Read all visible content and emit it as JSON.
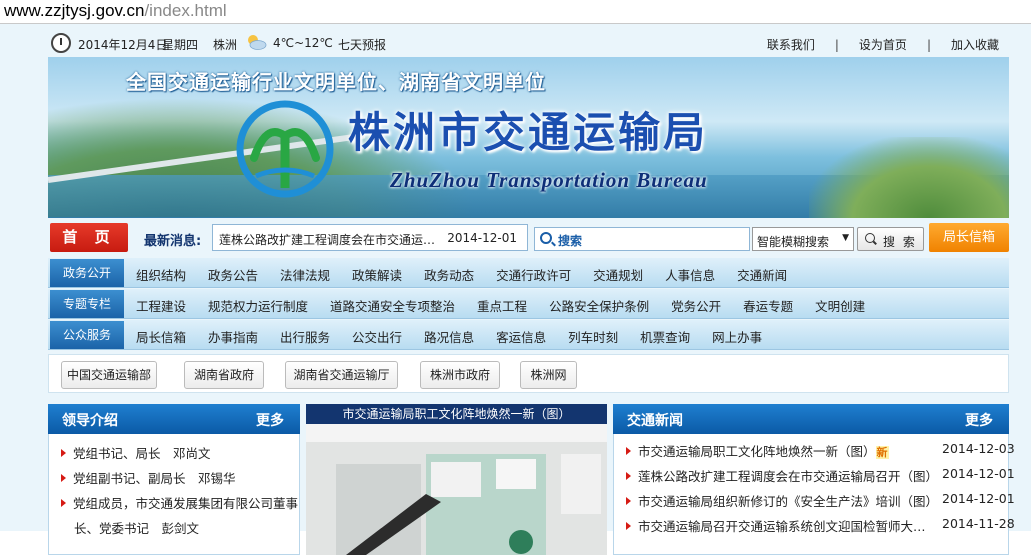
{
  "url": {
    "host": "www.zzjtysj.gov.cn",
    "path": "/index.html"
  },
  "topbar": {
    "date": "2014年12月4日",
    "weekday": "星期四",
    "city": "株洲",
    "temp": "4℃~12℃",
    "forecast": "七天预报",
    "links": [
      "联系我们",
      "设为首页",
      "加入收藏"
    ],
    "separator": "|"
  },
  "banner": {
    "slogan": "全国交通运输行业文明单位、湖南省文明单位",
    "title": "株洲市交通运输局",
    "subtitle": "ZhuZhou Transportation Bureau"
  },
  "searchbar": {
    "home": "首 页",
    "news_label": "最新消息:",
    "news_title": "莲株公路改扩建工程调度会在市交通运…",
    "news_date": "2014-12-01",
    "search_placeholder": "搜索",
    "search_mode": "智能模糊搜索",
    "search_button": "搜 索",
    "mailbox": "局长信箱"
  },
  "nav": [
    {
      "tag": "政务公开",
      "items": [
        "组织结构",
        "政务公告",
        "法律法规",
        "政策解读",
        "政务动态",
        "交通行政许可",
        "交通规划",
        "人事信息",
        "交通新闻"
      ]
    },
    {
      "tag": "专题专栏",
      "items": [
        "工程建设",
        "规范权力运行制度",
        "道路交通安全专项整治",
        "重点工程",
        "公路安全保护条例",
        "党务公开",
        "春运专题",
        "文明创建"
      ]
    },
    {
      "tag": "公众服务",
      "items": [
        "局长信箱",
        "办事指南",
        "出行服务",
        "公交出行",
        "路况信息",
        "客运信息",
        "列车时刻",
        "机票查询",
        "网上办事"
      ]
    }
  ],
  "quicklinks": [
    "中国交通运输部",
    "湖南省政府",
    "湖南省交通运输厅",
    "株洲市政府",
    "株洲网"
  ],
  "leaders": {
    "title": "领导介绍",
    "more": "更多",
    "items": [
      "党组书记、局长　邓尚文",
      "党组副书记、副局长　邓锡华",
      "党组成员，市交通发展集团有限公司董事",
      "长、党委书记　彭剑文"
    ]
  },
  "photo": {
    "caption": "市交通运输局职工文化阵地焕然一新（图）"
  },
  "news": {
    "title": "交通新闻",
    "more": "更多",
    "new_badge": "新",
    "items": [
      {
        "title": "市交通运输局职工文化阵地焕然一新（图）",
        "date": "2014-12-03",
        "is_new": true
      },
      {
        "title": "莲株公路改扩建工程调度会在市交通运输局召开（图）",
        "date": "2014-12-01"
      },
      {
        "title": "市交通运输局组织新修订的《安全生产法》培训（图）",
        "date": "2014-12-01"
      },
      {
        "title": "市交通运输局召开交通运输系统创文迎国检暂师大…",
        "date": "2014-11-28"
      }
    ]
  },
  "colors": {
    "nav_blue": "#1b63a8",
    "home_red": "#d61b14",
    "mailbox_orange": "#f08200",
    "panel_blue": "#0b5aa6"
  }
}
